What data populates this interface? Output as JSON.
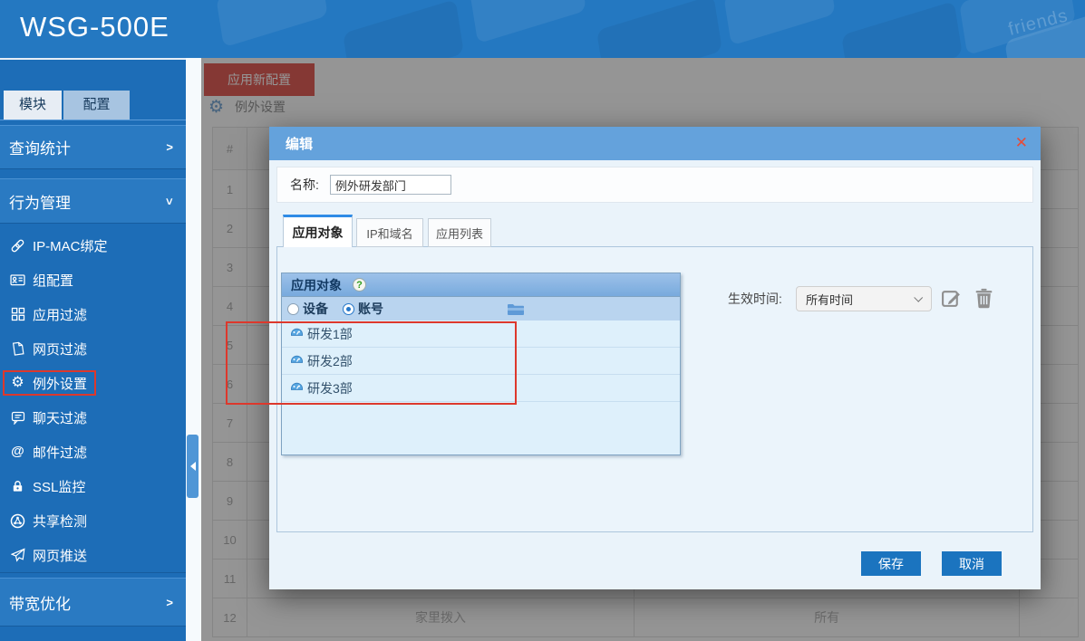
{
  "app": {
    "title": "WSG-500E",
    "header_key_text": "friends"
  },
  "colors": {
    "header_blue": "#2478c1",
    "sidebar_blue": "#1d6db7",
    "section_blue": "#2a7ac2",
    "modal_titlebar": "#64a2dc",
    "modal_body": "#eaf3fa",
    "panel_header": "#86b2e0",
    "primary_button": "#1b74bf",
    "apply_button_red": "#e0544e",
    "annotation_red": "#dd382c",
    "close_x_red": "#e64c38"
  },
  "sidebar": {
    "tabs": [
      {
        "label": "模块",
        "active": true
      },
      {
        "label": "配置",
        "active": false
      }
    ],
    "sections": [
      {
        "label": "查询统计",
        "state": "collapsed"
      },
      {
        "label": "行为管理",
        "state": "expanded"
      },
      {
        "label": "带宽优化",
        "state": "collapsed"
      }
    ],
    "items": [
      {
        "icon": "link-icon",
        "label": "IP-MAC绑定"
      },
      {
        "icon": "id-card-icon",
        "label": "组配置"
      },
      {
        "icon": "grid-icon",
        "label": "应用过滤"
      },
      {
        "icon": "webpage-icon",
        "label": "网页过滤"
      },
      {
        "icon": "gear-icon",
        "label": "例外设置",
        "highlighted": true
      },
      {
        "icon": "chat-icon",
        "label": "聊天过滤"
      },
      {
        "icon": "at-icon",
        "label": "邮件过滤"
      },
      {
        "icon": "lock-icon",
        "label": "SSL监控"
      },
      {
        "icon": "share-icon",
        "label": "共享检测"
      },
      {
        "icon": "paper-plane-icon",
        "label": "网页推送"
      }
    ]
  },
  "content": {
    "apply_button": "应用新配置",
    "breadcrumb": "例外设置",
    "table": {
      "header": "#",
      "rows": [
        {
          "n": "1"
        },
        {
          "n": "2"
        },
        {
          "n": "3"
        },
        {
          "n": "4"
        },
        {
          "n": "5"
        },
        {
          "n": "6"
        },
        {
          "n": "7"
        },
        {
          "n": "8"
        },
        {
          "n": "9"
        },
        {
          "n": "10"
        },
        {
          "n": "11"
        },
        {
          "n": "12",
          "col2": "家里拨入",
          "col3": "所有"
        }
      ]
    }
  },
  "modal": {
    "title": "编辑",
    "close_label": "✕",
    "name_label": "名称:",
    "name_value": "例外研发部门",
    "tabs": [
      {
        "label": "应用对象",
        "active": true
      },
      {
        "label": "IP和域名",
        "active": false
      },
      {
        "label": "应用列表",
        "active": false
      }
    ],
    "panel": {
      "title": "应用对象",
      "help": "?",
      "radios": [
        {
          "label": "设备",
          "checked": false
        },
        {
          "label": "账号",
          "checked": true
        }
      ],
      "items": [
        "研发1部",
        "研发2部",
        "研发3部"
      ]
    },
    "effective_time": {
      "label": "生效时间:",
      "value": "所有时间"
    },
    "buttons": {
      "save": "保存",
      "cancel": "取消"
    }
  }
}
